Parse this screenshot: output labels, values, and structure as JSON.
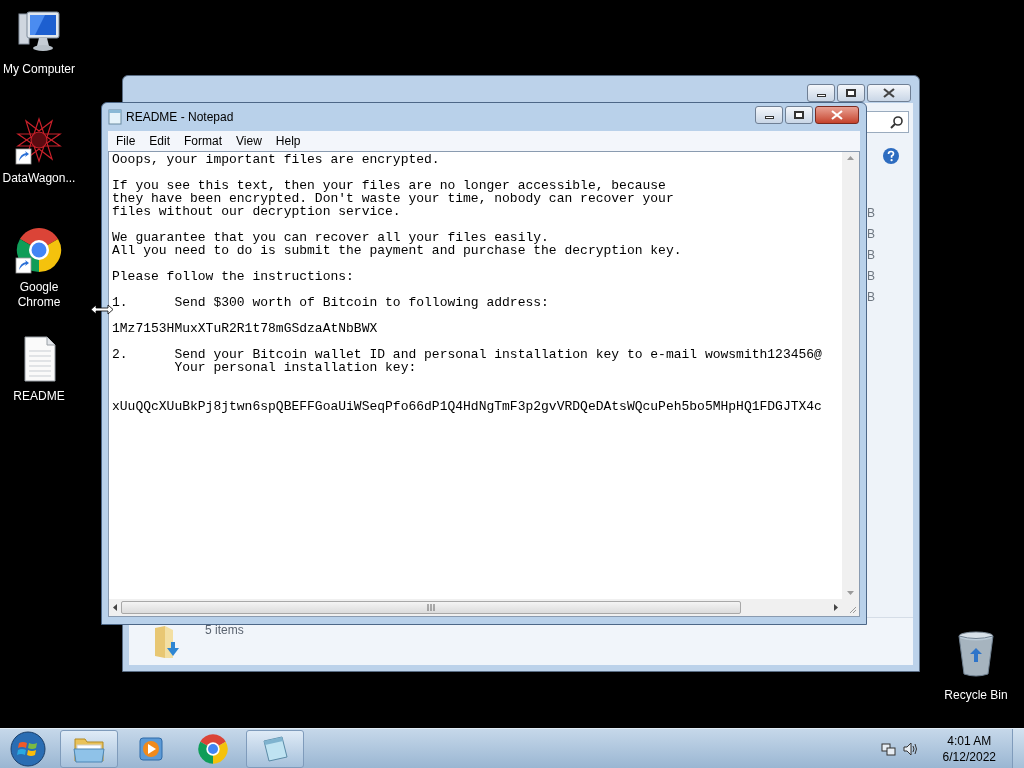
{
  "desktop_icons": [
    {
      "label": "My Computer",
      "kind": "computer",
      "shortcut": false
    },
    {
      "label": "DataWagon...",
      "kind": "app",
      "shortcut": true
    },
    {
      "label": "Google Chrome",
      "kind": "chrome",
      "shortcut": true
    },
    {
      "label": "README",
      "kind": "document",
      "shortcut": false
    }
  ],
  "recycle_bin": {
    "label": "Recycle Bin"
  },
  "explorer": {
    "column_1": [
      "B",
      "B",
      "B",
      "B",
      "B"
    ],
    "status": "5 items"
  },
  "notepad": {
    "title": "README - Notepad",
    "menu": [
      "File",
      "Edit",
      "Format",
      "View",
      "Help"
    ],
    "paragraphs": [
      {
        "kind": "text",
        "lines": [
          "Ooops, your important files are encrypted."
        ]
      },
      {
        "kind": "text",
        "lines": [
          "If you see this text, then your files are no longer accessible, because",
          "they have been encrypted. Don't waste your time, nobody can recover your",
          "files without our decryption service."
        ]
      },
      {
        "kind": "text",
        "lines": [
          "We guarantee that you can recover all your files easily.",
          "All you need to do is submit the payment and purchase the decryption key."
        ]
      },
      {
        "kind": "text",
        "lines": [
          "Please follow the instructions:"
        ]
      },
      {
        "kind": "text",
        "lines": [
          "1.      Send $300 worth of Bitcoin to following address:"
        ]
      },
      {
        "kind": "text",
        "lines": [
          "1Mz7153HMuxXTuR2R1t78mGSdzaAtNbBWX"
        ]
      },
      {
        "kind": "text",
        "lines": [
          "2.      Send your Bitcoin wallet ID and personal installation key to e-mail wowsmith123456@",
          "        Your personal installation key:"
        ]
      },
      {
        "kind": "key",
        "lines": [
          "xUuQQcXUuBkPj8jtwn6spQBEFFGoaUiWSeqPfo66dP1Q4HdNgTmF3p2gvVRDQeDAtsWQcuPeh5bo5MHpHQ1FDGJTX4c"
        ]
      }
    ]
  },
  "taskbar": {
    "items": [
      {
        "kind": "explorer",
        "running": true
      },
      {
        "kind": "media",
        "running": false
      },
      {
        "kind": "chrome",
        "running": false
      },
      {
        "kind": "notepad",
        "running": true
      }
    ],
    "time": "4:01 AM",
    "date": "6/12/2022"
  }
}
